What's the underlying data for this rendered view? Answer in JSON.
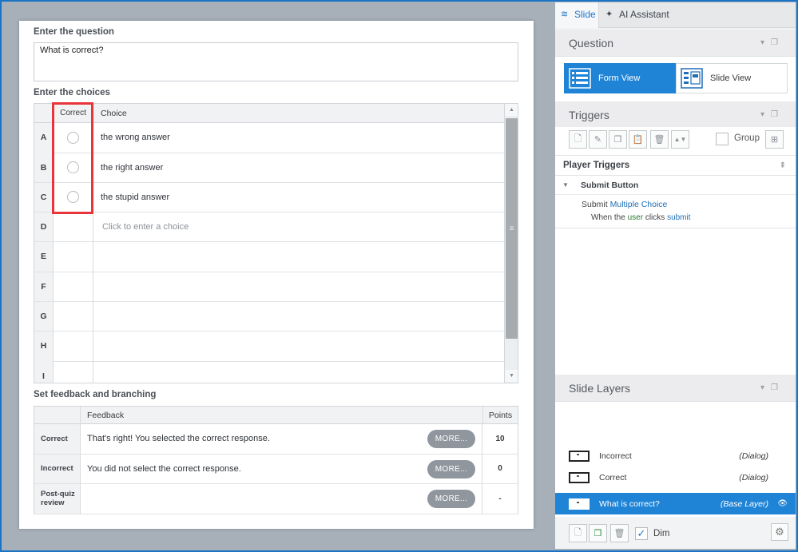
{
  "form": {
    "question_label": "Enter the question",
    "question_value": "What is correct?",
    "choices_label": "Enter the choices",
    "col_correct": "Correct",
    "col_choice": "Choice",
    "rows": [
      {
        "letter": "A",
        "text": "the wrong answer",
        "has_radio": true
      },
      {
        "letter": "B",
        "text": "the right answer",
        "has_radio": true
      },
      {
        "letter": "C",
        "text": "the stupid answer",
        "has_radio": true
      },
      {
        "letter": "D",
        "text": "",
        "has_radio": false
      },
      {
        "letter": "E",
        "text": "",
        "has_radio": false
      },
      {
        "letter": "F",
        "text": "",
        "has_radio": false
      },
      {
        "letter": "G",
        "text": "",
        "has_radio": false
      },
      {
        "letter": "H",
        "text": "",
        "has_radio": false
      },
      {
        "letter": "I",
        "text": "",
        "has_radio": false
      }
    ],
    "choice_placeholder": "Click to enter a choice",
    "feedback_label": "Set feedback and branching",
    "col_feedback": "Feedback",
    "col_points": "Points",
    "more_label": "MORE...",
    "feedback": [
      {
        "label": "Correct",
        "text": "That's right!  You selected the correct response.",
        "points": "10"
      },
      {
        "label": "Incorrect",
        "text": "You did not select the correct response.",
        "points": "0"
      },
      {
        "label": "Post-quiz review",
        "text": "",
        "points": "-"
      }
    ]
  },
  "right": {
    "tab_slide": "Slide",
    "tab_ai": "AI Assistant",
    "question_title": "Question",
    "form_view": "Form View",
    "slide_view": "Slide View",
    "triggers_title": "Triggers",
    "group_label": "Group",
    "player_triggers": "Player Triggers",
    "submit_button": "Submit Button",
    "trig_action": "Submit",
    "trig_target": "Multiple Choice",
    "trig_when": "When the",
    "trig_user": "user",
    "trig_clicks": "clicks",
    "trig_submit": "submit",
    "layers_title": "Slide Layers",
    "layers": [
      {
        "name": "Incorrect",
        "type": "(Dialog)"
      },
      {
        "name": "Correct",
        "type": "(Dialog)"
      }
    ],
    "base_layer": {
      "name": "What is correct?",
      "type": "(Base Layer)"
    },
    "dim_label": "Dim"
  },
  "colors": {
    "accent": "#1f84d6",
    "highlight": "#e8353b"
  }
}
